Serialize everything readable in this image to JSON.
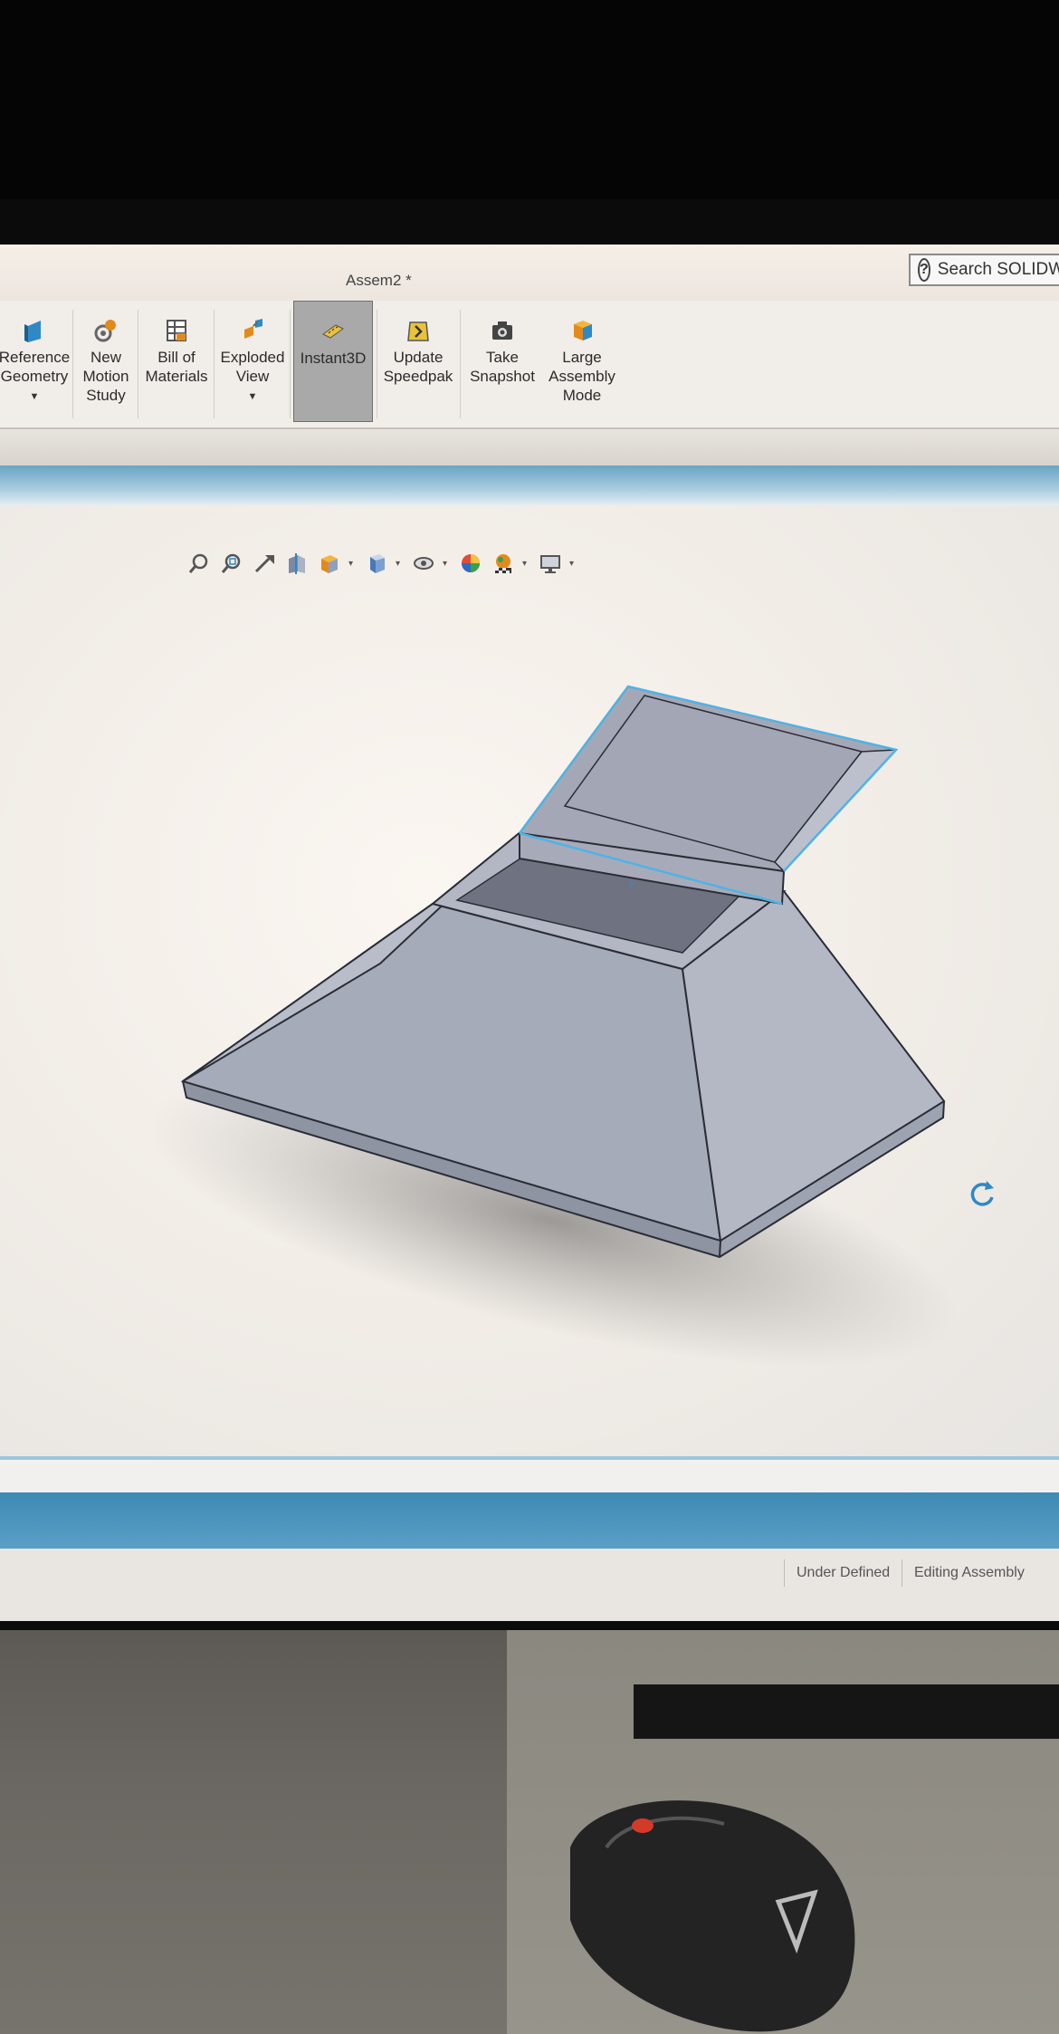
{
  "window": {
    "title": "Assem2 *",
    "search_label": "Search SOLIDW"
  },
  "ribbon": {
    "items": [
      {
        "label1": "Reference",
        "label2": "Geometry",
        "label3": "",
        "icon": "reference-geometry-icon"
      },
      {
        "label1": "New",
        "label2": "Motion",
        "label3": "Study",
        "icon": "motion-study-icon"
      },
      {
        "label1": "Bill of",
        "label2": "Materials",
        "label3": "",
        "icon": "bill-of-materials-icon"
      },
      {
        "label1": "Exploded",
        "label2": "View",
        "label3": "",
        "icon": "exploded-view-icon"
      },
      {
        "label1": "Instant3D",
        "label2": "",
        "label3": "",
        "icon": "instant3d-icon",
        "active": true
      },
      {
        "label1": "Update",
        "label2": "Speedpak",
        "label3": "",
        "icon": "speedpak-icon"
      },
      {
        "label1": "Take",
        "label2": "Snapshot",
        "label3": "",
        "icon": "camera-icon"
      },
      {
        "label1": "Large",
        "label2": "Assembly",
        "label3": "Mode",
        "icon": "large-assembly-icon"
      }
    ]
  },
  "heads_up_toolbar": [
    "zoom-to-fit-icon",
    "zoom-to-area-icon",
    "previous-view-icon",
    "section-view-icon",
    "view-orientation-icon",
    "display-style-icon",
    "hide-show-icon",
    "edit-appearance-icon",
    "apply-scene-icon",
    "view-settings-icon"
  ],
  "status": {
    "constraint": "Under Defined",
    "mode": "Editing Assembly"
  },
  "colors": {
    "accent_blue": "#3e8ab5",
    "part_gray": "#a3a7b4",
    "selection_highlight": "#4fb3e6",
    "active_button": "#a9a9a9"
  }
}
